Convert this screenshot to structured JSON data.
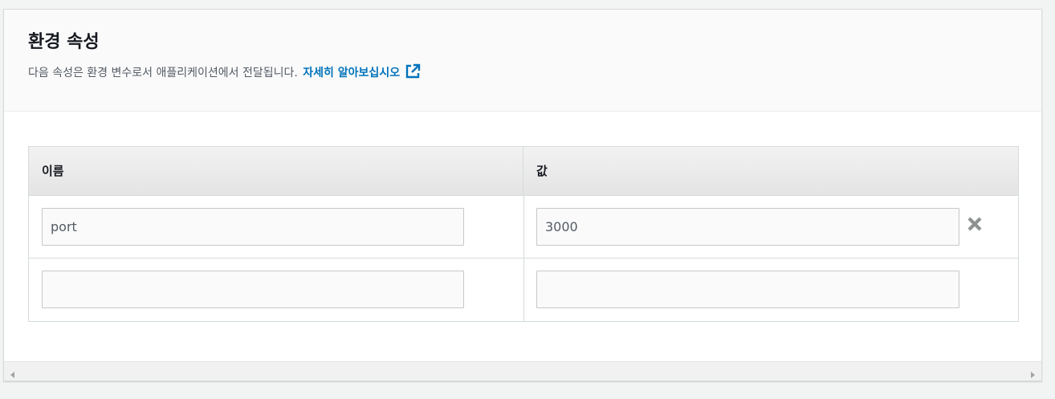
{
  "panel": {
    "title": "환경 속성",
    "description": "다음 속성은 환경 변수로서 애플리케이션에서 전달됩니다.",
    "learn_more_label": "자세히 알아보십시오",
    "link_color": "#0073bb"
  },
  "table": {
    "columns": [
      "이름",
      "값"
    ],
    "rows": [
      {
        "name": "port",
        "value": "3000",
        "removable": true,
        "remove_icon": "close-x-icon"
      },
      {
        "name": "",
        "value": "",
        "removable": false
      }
    ]
  },
  "icons": {
    "external_link": "external-link-icon",
    "scroll_left": "scroll-left-arrow-icon",
    "scroll_right": "scroll-right-arrow-icon"
  }
}
